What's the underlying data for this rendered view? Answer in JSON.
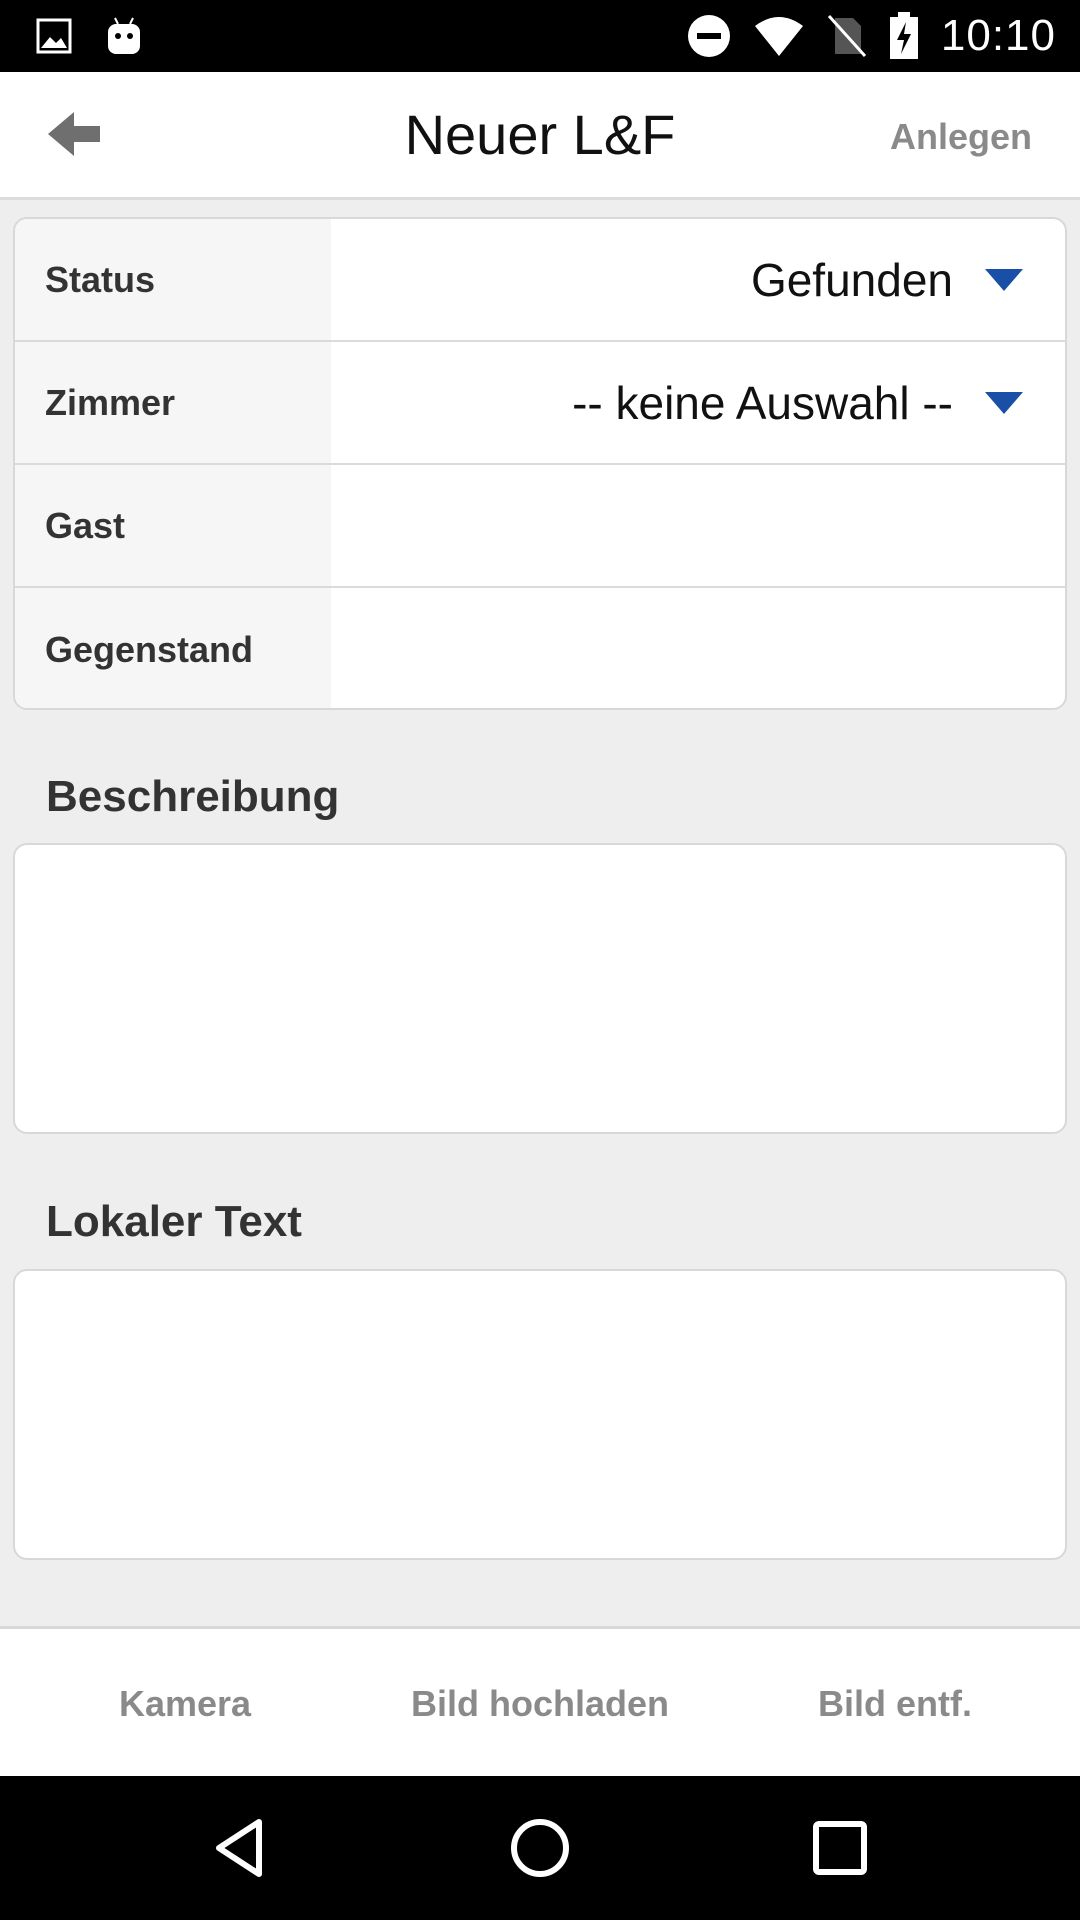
{
  "status_bar": {
    "time": "10:10",
    "icons": [
      "image-icon",
      "android-icon",
      "do-not-disturb-icon",
      "wifi-icon",
      "no-sim-icon",
      "battery-charging-icon"
    ]
  },
  "app_bar": {
    "back_icon": "back-arrow-icon",
    "title": "Neuer L&F",
    "action_label": "Anlegen"
  },
  "form": {
    "rows": [
      {
        "label": "Status",
        "value": "Gefunden",
        "dropdown": true
      },
      {
        "label": "Zimmer",
        "value": "-- keine Auswahl --",
        "dropdown": true
      },
      {
        "label": "Gast",
        "value": "",
        "dropdown": false
      },
      {
        "label": "Gegenstand",
        "value": "",
        "dropdown": false
      }
    ]
  },
  "description": {
    "label": "Beschreibung",
    "value": ""
  },
  "local_text": {
    "label": "Lokaler Text",
    "value": ""
  },
  "toolbar": {
    "camera_label": "Kamera",
    "upload_label": "Bild hochladen",
    "remove_label": "Bild entf."
  },
  "nav_bar": {
    "icons": [
      "nav-back-icon",
      "nav-home-icon",
      "nav-recents-icon"
    ]
  },
  "colors": {
    "dropdown_caret": "#1a4fa8",
    "action_text": "#8a8a8a",
    "background": "#eeeeee"
  }
}
